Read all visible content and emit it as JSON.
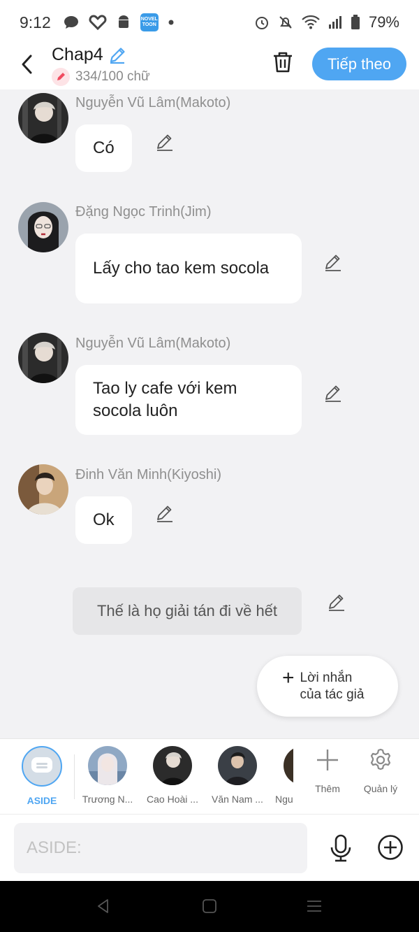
{
  "status_bar": {
    "time": "9:12",
    "novel_badge": "NOVEL TOON",
    "battery": "79%"
  },
  "header": {
    "title": "Chap4",
    "word_count": "334/100 chữ",
    "next_label": "Tiếp theo"
  },
  "messages": [
    {
      "speaker": "Nguyễn Vũ Lâm(Makoto)",
      "text": "Có"
    },
    {
      "speaker": "Đặng Ngọc Trinh(Jim)",
      "text": "Lấy cho tao kem socola"
    },
    {
      "speaker": "Nguyễn Vũ Lâm(Makoto)",
      "text": "Tao ly cafe với kem socola luôn"
    },
    {
      "speaker": "Đinh Văn Minh(Kiyoshi)",
      "text": "Ok"
    }
  ],
  "aside_text": "Thế là họ giải tán đi về hết",
  "author_note_label": "Lời nhắn của tác giả",
  "characters": [
    {
      "label": "ASIDE"
    },
    {
      "label": "Trương N..."
    },
    {
      "label": "Cao Hoài ..."
    },
    {
      "label": "Văn Nam ..."
    },
    {
      "label": "Ngu"
    }
  ],
  "tools": {
    "add_label": "Thêm",
    "manage_label": "Quản lý"
  },
  "input": {
    "placeholder": "ASIDE:",
    "value": ""
  },
  "colors": {
    "accent": "#4fa6f2",
    "background": "#f2f2f4"
  }
}
